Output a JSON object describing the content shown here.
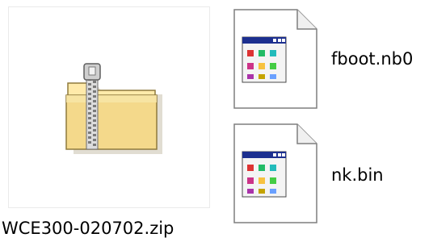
{
  "files": [
    {
      "name": "WCE300-020702.zip",
      "icon": "zip-folder-icon"
    },
    {
      "name": "fboot.nb0",
      "icon": "application-file-icon"
    },
    {
      "name": "nk.bin",
      "icon": "application-file-icon"
    }
  ],
  "colors": {
    "page_bg": "#ffffff",
    "tile_border": "#eaeaea",
    "folder_body": "#f4d98b",
    "folder_tab": "#ffeaaa",
    "zipper": "#8a8a8a",
    "window_titlebar": "#1c2f8f"
  }
}
